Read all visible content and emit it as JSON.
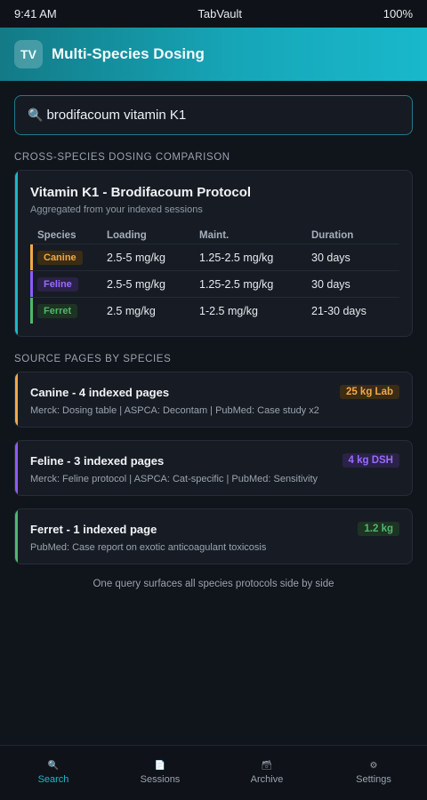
{
  "status_bar": {
    "time": "9:41 AM",
    "app": "TabVault",
    "battery": "100%"
  },
  "header": {
    "logo_text": "TV",
    "title": "Multi-Species Dosing"
  },
  "search": {
    "icon": "🔍",
    "query": "brodifacoum vitamin K1"
  },
  "comparison": {
    "section_label": "Cross-species dosing comparison",
    "title": "Vitamin K1 - Brodifacoum Protocol",
    "subtitle": "Aggregated from your indexed sessions",
    "columns": [
      "Species",
      "Loading",
      "Maint.",
      "Duration"
    ],
    "rows": [
      {
        "species": "Canine",
        "loading": "2.5-5 mg/kg",
        "maint": "1.25-2.5 mg/kg",
        "duration": "30 days",
        "color": "#f0a848"
      },
      {
        "species": "Feline",
        "loading": "2.5-5 mg/kg",
        "maint": "1.25-2.5 mg/kg",
        "duration": "30 days",
        "color": "#8a5cf6"
      },
      {
        "species": "Ferret",
        "loading": "2.5 mg/kg",
        "maint": "1-2.5 mg/kg",
        "duration": "21-30 days",
        "color": "#4fb767"
      }
    ]
  },
  "sources": {
    "section_label": "Source pages by species",
    "items": [
      {
        "title": "Canine - 4 indexed pages",
        "badge": "25 kg Lab",
        "desc": "Merck: Dosing table | ASPCA: Decontam | PubMed: Case study x2",
        "color": "#f0a848",
        "badge_bg": "#3a2c15"
      },
      {
        "title": "Feline - 3 indexed pages",
        "badge": "4 kg DSH",
        "desc": "Merck: Feline protocol | ASPCA: Cat-specific | PubMed: Sensitivity",
        "color": "#8a5cf6",
        "badge_bg": "#2a2247"
      },
      {
        "title": "Ferret - 1 indexed page",
        "badge": "1.2 kg",
        "desc": "PubMed: Case report on exotic anticoagulant toxicosis",
        "color": "#4fb767",
        "badge_bg": "#1d3323"
      }
    ]
  },
  "footer_note": "One query surfaces all species protocols side by side",
  "tabs": [
    {
      "label": "Search",
      "icon": "🔍",
      "icon_name": "search-icon",
      "active": true
    },
    {
      "label": "Sessions",
      "icon": "📄",
      "icon_name": "document-icon",
      "active": false
    },
    {
      "label": "Archive",
      "icon": "🗃",
      "icon_name": "archive-icon",
      "active": false
    },
    {
      "label": "Settings",
      "icon": "⚙",
      "icon_name": "gear-icon",
      "active": false
    }
  ]
}
